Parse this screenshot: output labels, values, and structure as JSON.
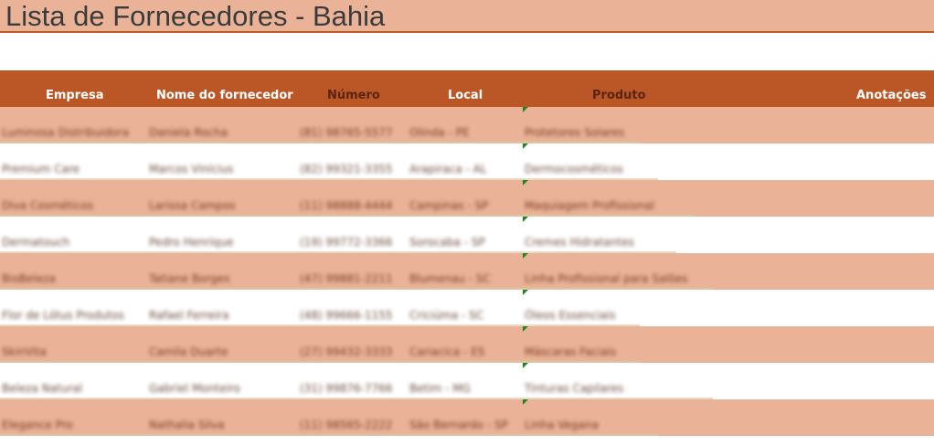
{
  "sheet": {
    "title": "Lista de Fornecedores - Bahia"
  },
  "table": {
    "headers": {
      "empresa": "Empresa",
      "nome": "Nome do fornecedor",
      "numero": "Número",
      "local": "Local",
      "produto": "Produto",
      "anotacoes": "Anotações"
    },
    "rows": [
      {
        "empresa": "Luminosa Distribuidora",
        "nome": "Daniela Rocha",
        "numero": "(81) 98765-5577",
        "local": "Olinda - PE",
        "produto": "Protetores Solares",
        "anotacoes": ""
      },
      {
        "empresa": "Premium Care",
        "nome": "Marcos Vinícius",
        "numero": "(82) 99321-3355",
        "local": "Arapiraca - AL",
        "produto": "Dermocosméticos",
        "anotacoes": ""
      },
      {
        "empresa": "Diva Cosméticos",
        "nome": "Larissa Campos",
        "numero": "(11) 98888-4444",
        "local": "Campinas - SP",
        "produto": "Maquiagem Profissional",
        "anotacoes": ""
      },
      {
        "empresa": "Dermatouch",
        "nome": "Pedro Henrique",
        "numero": "(19) 99772-3366",
        "local": "Sorocaba - SP",
        "produto": "Cremes Hidratantes",
        "anotacoes": ""
      },
      {
        "empresa": "BioBeleza",
        "nome": "Tatiane Borges",
        "numero": "(47) 99881-2211",
        "local": "Blumenau - SC",
        "produto": "Linha Profissional para Salões",
        "anotacoes": ""
      },
      {
        "empresa": "Flor de Lótus Produtos",
        "nome": "Rafael Ferreira",
        "numero": "(48) 99666-1155",
        "local": "Criciúma - SC",
        "produto": "Óleos Essenciais",
        "anotacoes": ""
      },
      {
        "empresa": "SkinVita",
        "nome": "Camila Duarte",
        "numero": "(27) 99432-3333",
        "local": "Cariacica - ES",
        "produto": "Máscaras Faciais",
        "anotacoes": ""
      },
      {
        "empresa": "Beleza Natural",
        "nome": "Gabriel Monteiro",
        "numero": "(31) 99876-7766",
        "local": "Betim - MG",
        "produto": "Tinturas Capilares",
        "anotacoes": ""
      },
      {
        "empresa": "Elegance Pro",
        "nome": "Nathalia Silva",
        "numero": "(11) 98565-2222",
        "local": "São Bernardo - SP",
        "produto": "Linha Vegana",
        "anotacoes": ""
      }
    ]
  }
}
